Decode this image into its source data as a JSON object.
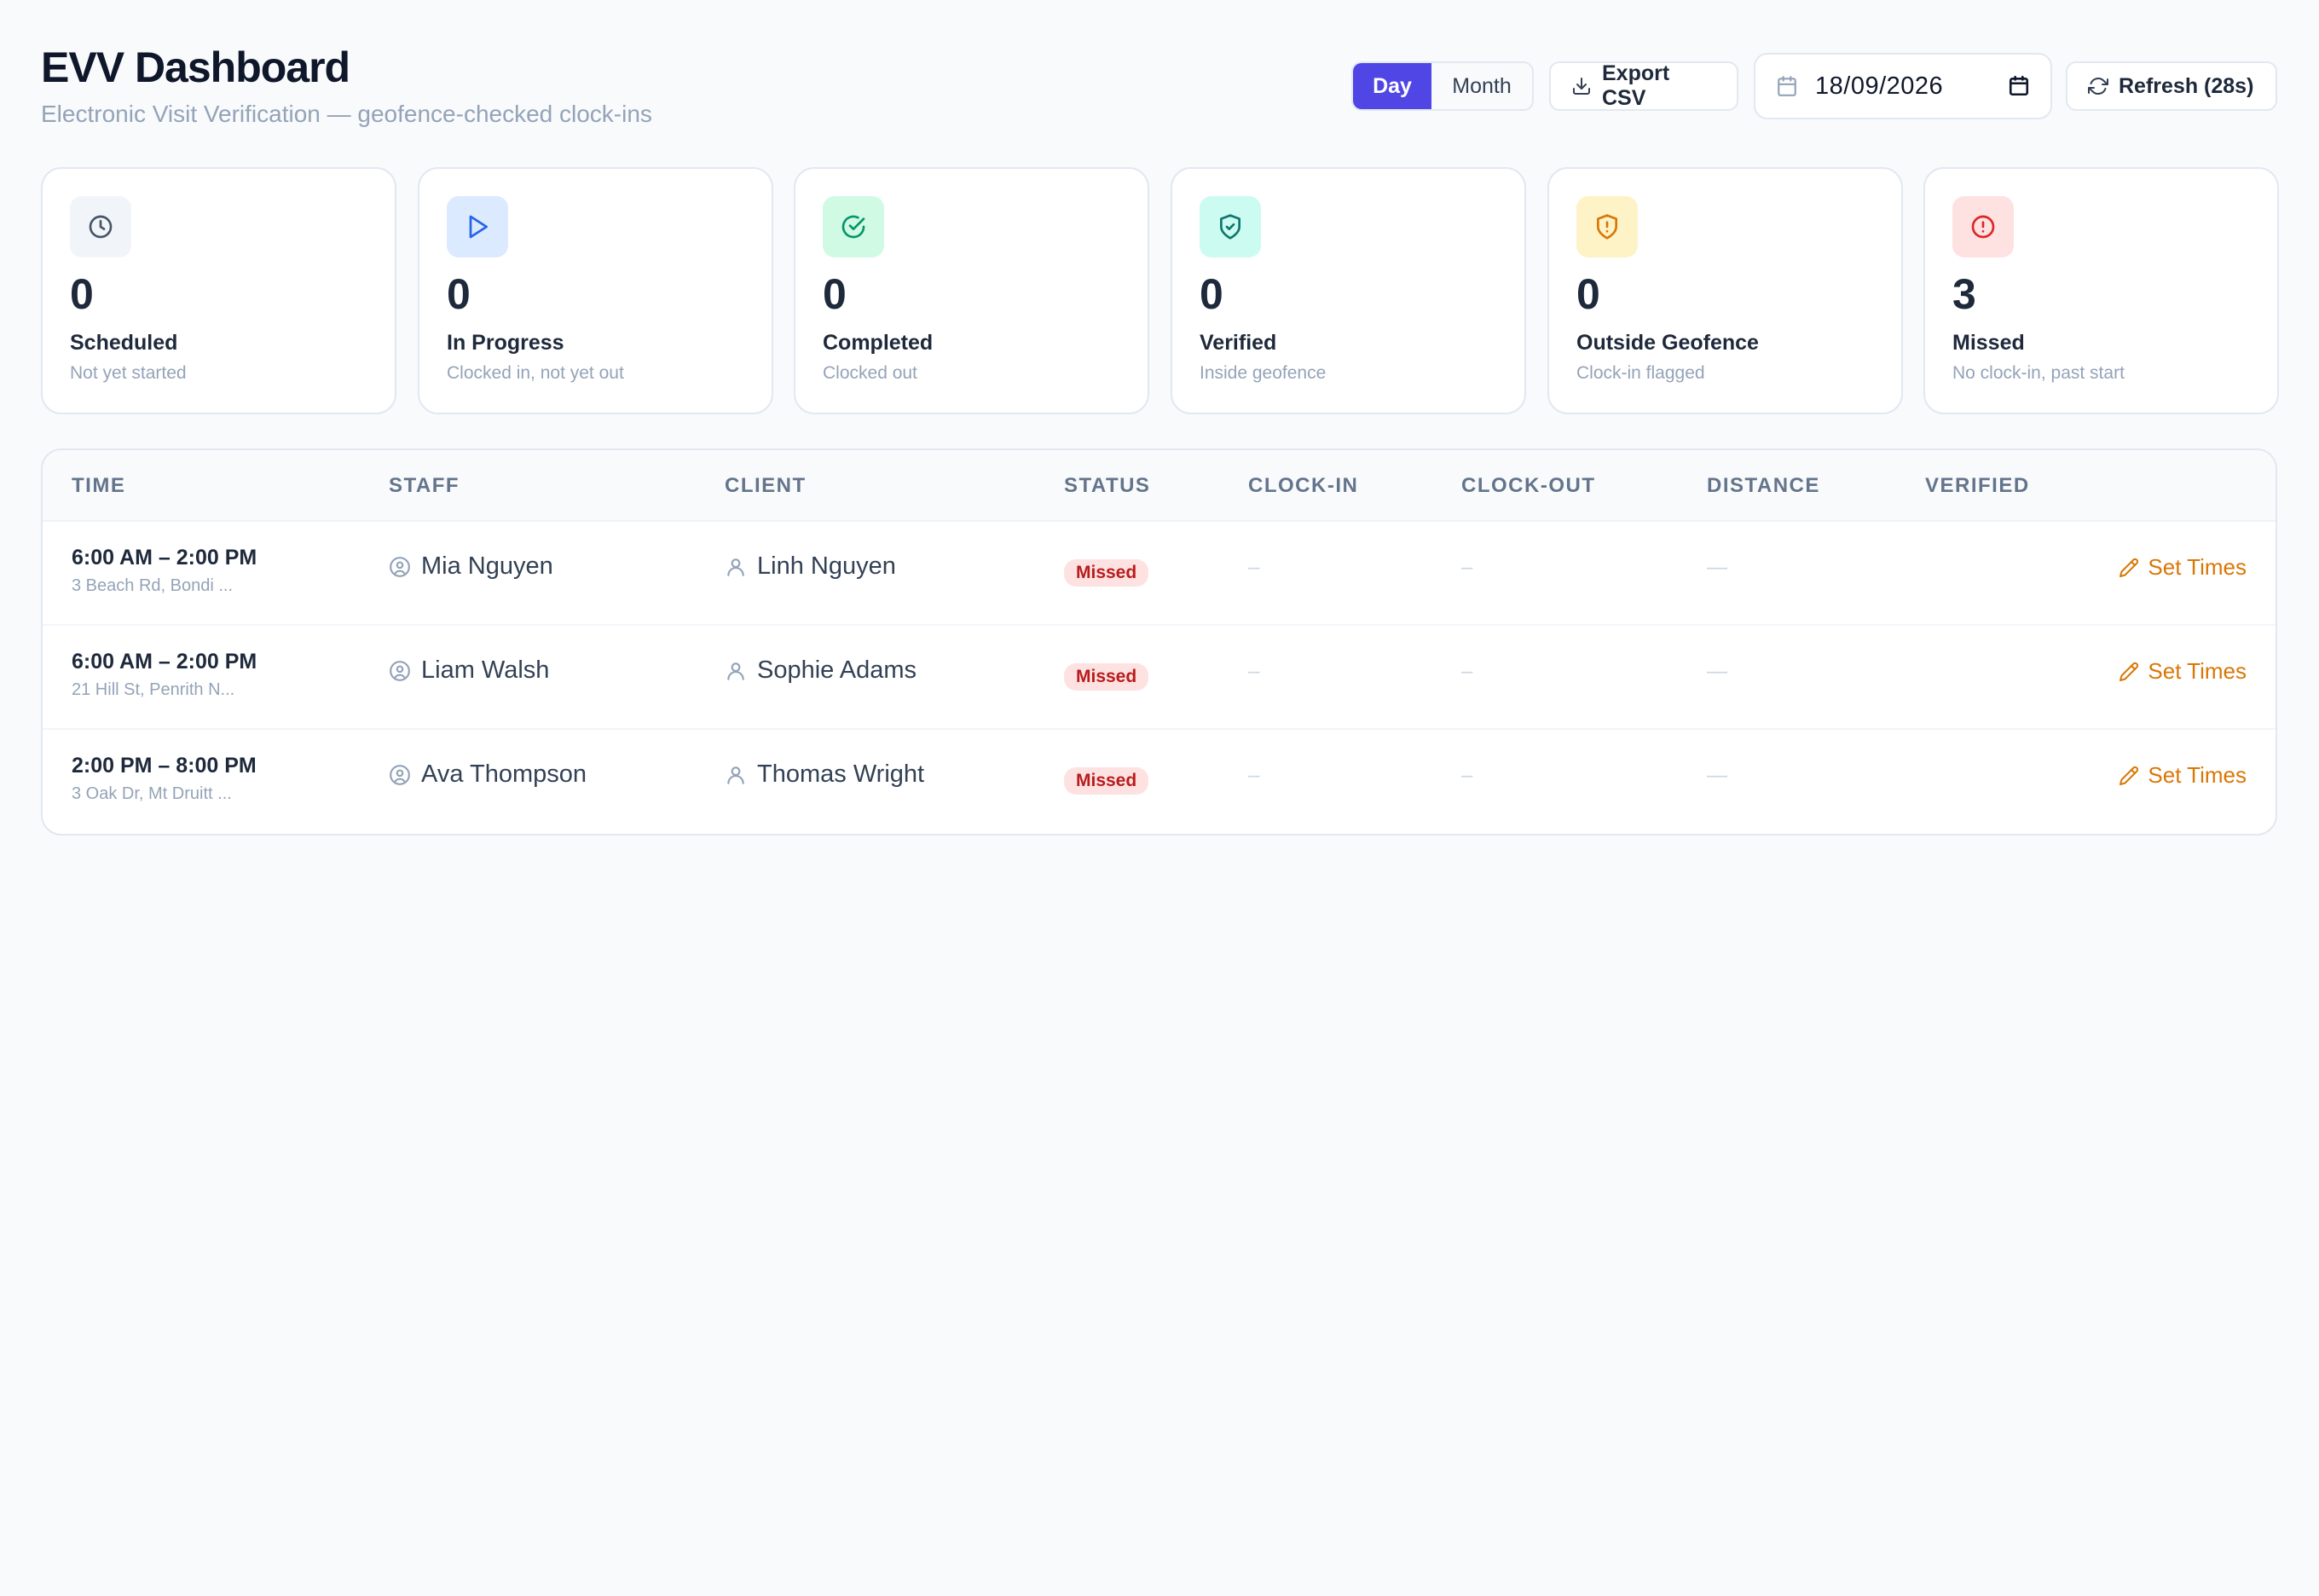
{
  "header": {
    "title": "EVV Dashboard",
    "subtitle": "Electronic Visit Verification — geofence-checked clock-ins"
  },
  "controls": {
    "view_toggle": [
      "Day",
      "Month"
    ],
    "active_view": "Day",
    "export_label": "Export CSV",
    "date_value": "18/09/2026",
    "refresh_label": "Refresh (28s)"
  },
  "cards": [
    {
      "count": "0",
      "label": "Scheduled",
      "sub": "Not yet started",
      "icon": "clock-icon",
      "bg": "#f1f5f9",
      "fg": "#475569"
    },
    {
      "count": "0",
      "label": "In Progress",
      "sub": "Clocked in, not yet out",
      "icon": "play-icon",
      "bg": "#dbeafe",
      "fg": "#2563eb"
    },
    {
      "count": "0",
      "label": "Completed",
      "sub": "Clocked out",
      "icon": "check-circle-icon",
      "bg": "#d1fae5",
      "fg": "#059669"
    },
    {
      "count": "0",
      "label": "Verified",
      "sub": "Inside geofence",
      "icon": "shield-check-icon",
      "bg": "#ccfbf1",
      "fg": "#0f766e"
    },
    {
      "count": "0",
      "label": "Outside Geofence",
      "sub": "Clock-in flagged",
      "icon": "shield-alert-icon",
      "bg": "#fef3c7",
      "fg": "#d97706"
    },
    {
      "count": "3",
      "label": "Missed",
      "sub": "No clock-in, past start",
      "icon": "alert-circle-icon",
      "bg": "#fee2e2",
      "fg": "#dc2626"
    }
  ],
  "table": {
    "columns": [
      "TIME",
      "STAFF",
      "CLIENT",
      "STATUS",
      "CLOCK-IN",
      "CLOCK-OUT",
      "DISTANCE",
      "VERIFIED"
    ],
    "rows": [
      {
        "time": "6:00 AM – 2:00 PM",
        "address": "3 Beach Rd, Bondi ...",
        "staff": "Mia Nguyen",
        "client": "Linh Nguyen",
        "status": "Missed",
        "clock_in": "–",
        "clock_out": "–",
        "distance": "—",
        "action": "Set Times"
      },
      {
        "time": "6:00 AM – 2:00 PM",
        "address": "21 Hill St, Penrith N...",
        "staff": "Liam Walsh",
        "client": "Sophie Adams",
        "status": "Missed",
        "clock_in": "–",
        "clock_out": "–",
        "distance": "—",
        "action": "Set Times"
      },
      {
        "time": "2:00 PM – 8:00 PM",
        "address": "3 Oak Dr, Mt Druitt ...",
        "staff": "Ava Thompson",
        "client": "Thomas Wright",
        "status": "Missed",
        "clock_in": "–",
        "clock_out": "–",
        "distance": "—",
        "action": "Set Times"
      }
    ]
  },
  "colors": {
    "accent": "#4f46e5",
    "missed_bg": "#fee2e2",
    "missed_fg": "#b91c1c",
    "action": "#d97706"
  }
}
